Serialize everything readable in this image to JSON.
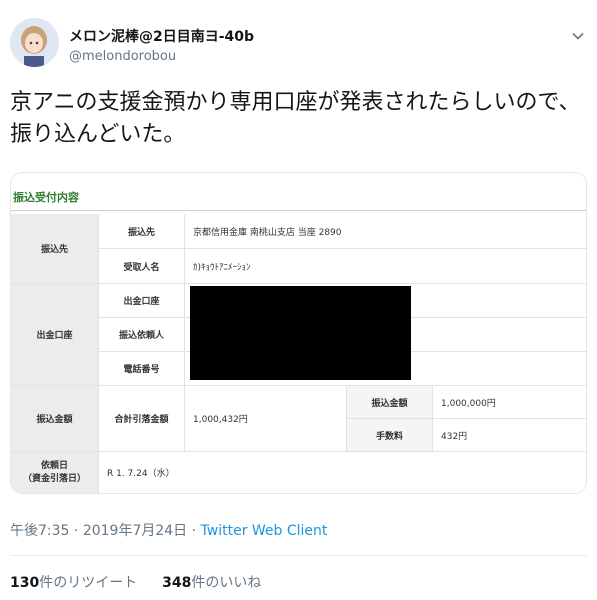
{
  "user": {
    "display_name": "メロン泥棒@2日目南ヨ-40b",
    "handle": "@melondorobou"
  },
  "tweet": {
    "text": "京アニの支援金預かり専用口座が発表されたらしいので、振り込んどいた。"
  },
  "card": {
    "title": "振込受付内容",
    "rows": {
      "group_payee": "振込先",
      "payee_label": "振込先",
      "payee_value": "京都信用金庫  南桃山支店  当座  2890",
      "recipient_label": "受取人名",
      "recipient_value": "ｶ)ｷｮｳﾄｱﾆﾒｰｼｮﾝ",
      "group_source": "出金口座",
      "source_label": "出金口座",
      "requester_label": "振込依頼人",
      "phone_label": "電話番号",
      "group_amount": "振込金額",
      "total_label": "合計引落金額",
      "total_value": "1,000,432円",
      "transfer_label": "振込金額",
      "transfer_value": "1,000,000円",
      "fee_label": "手数料",
      "fee_value": "432円",
      "date_label_1": "依頼日",
      "date_label_2": "（資金引落日）",
      "date_value": "R 1. 7.24（水）"
    }
  },
  "meta": {
    "time": "午後7:35",
    "separator": " · ",
    "date": "2019年7月24日",
    "separator2": " · ",
    "client": "Twitter Web Client"
  },
  "stats": {
    "retweets_count": "130",
    "retweets_label": "件のリツイート",
    "likes_count": "348",
    "likes_label": "件のいいね"
  },
  "colors": {
    "accent": "#1b95e0",
    "title_green": "#2e7d32"
  },
  "icons": {
    "avatar": "anime-avatar",
    "menu": "chevron-down-icon"
  }
}
